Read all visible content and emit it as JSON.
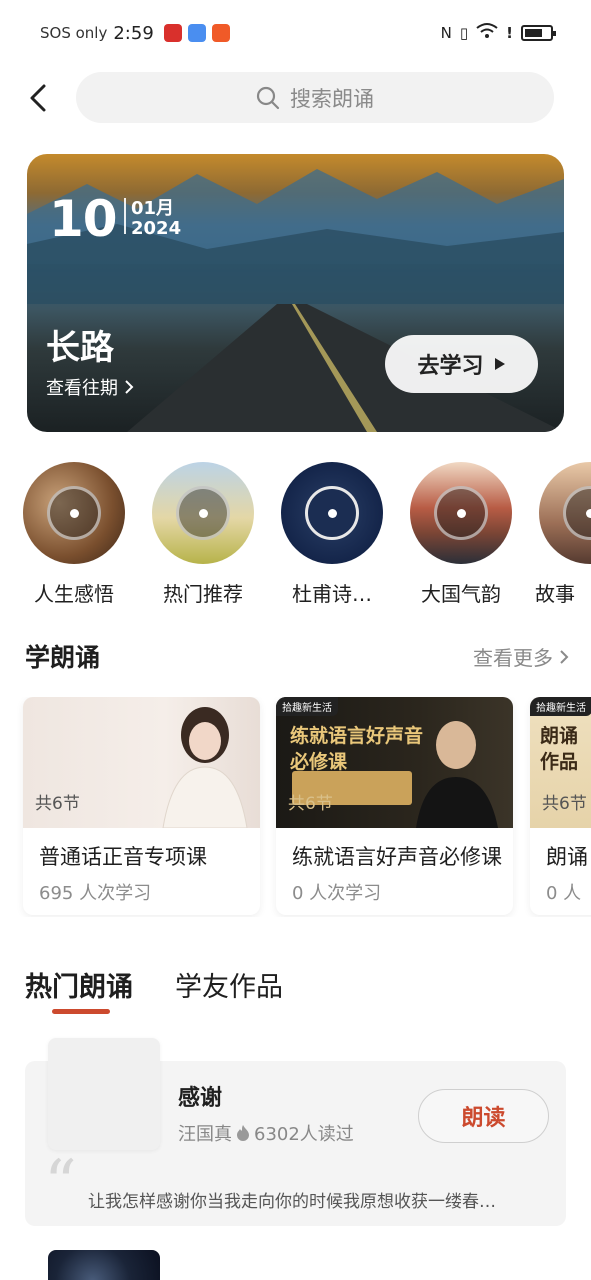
{
  "status_bar": {
    "carrier": "SOS only",
    "time": "2:59",
    "signal_label": "6"
  },
  "header": {
    "search_placeholder": "搜索朗诵"
  },
  "banner": {
    "day": "10",
    "month": "01月",
    "year": "2024",
    "title": "长路",
    "subtitle": "查看往期",
    "cta": "去学习"
  },
  "categories": [
    {
      "label": "人生感悟"
    },
    {
      "label": "热门推荐"
    },
    {
      "label": "杜甫诗…"
    },
    {
      "label": "大国气韵"
    },
    {
      "label": "故事"
    }
  ],
  "learn": {
    "title": "学朗诵",
    "more": "查看更多",
    "courses": [
      {
        "count": "共6节",
        "name": "普通话正音专项课",
        "stat": "695 人次学习",
        "headline": "",
        "tag": ""
      },
      {
        "count": "共6节",
        "name": "练就语言好声音必修课",
        "stat": "0 人次学习",
        "headline": "练就语言好声音\n必修课",
        "tag": "拾趣新生活"
      },
      {
        "count": "共6节",
        "name": "朗诵",
        "stat": "0 人",
        "headline": "朗诵\n作品",
        "tag": "拾趣新生活"
      }
    ]
  },
  "tabs": [
    {
      "label": "热门朗诵"
    },
    {
      "label": "学友作品"
    }
  ],
  "poem": {
    "title": "感谢",
    "author": "汪国真",
    "reads": "6302人读过",
    "button": "朗读",
    "excerpt": "让我怎样感谢你当我走向你的时候我原想收获一缕春…"
  },
  "colors": {
    "accent": "#cc4a2e",
    "search_bg": "#f2f2f2",
    "card_bg": "#f4f4f4"
  }
}
